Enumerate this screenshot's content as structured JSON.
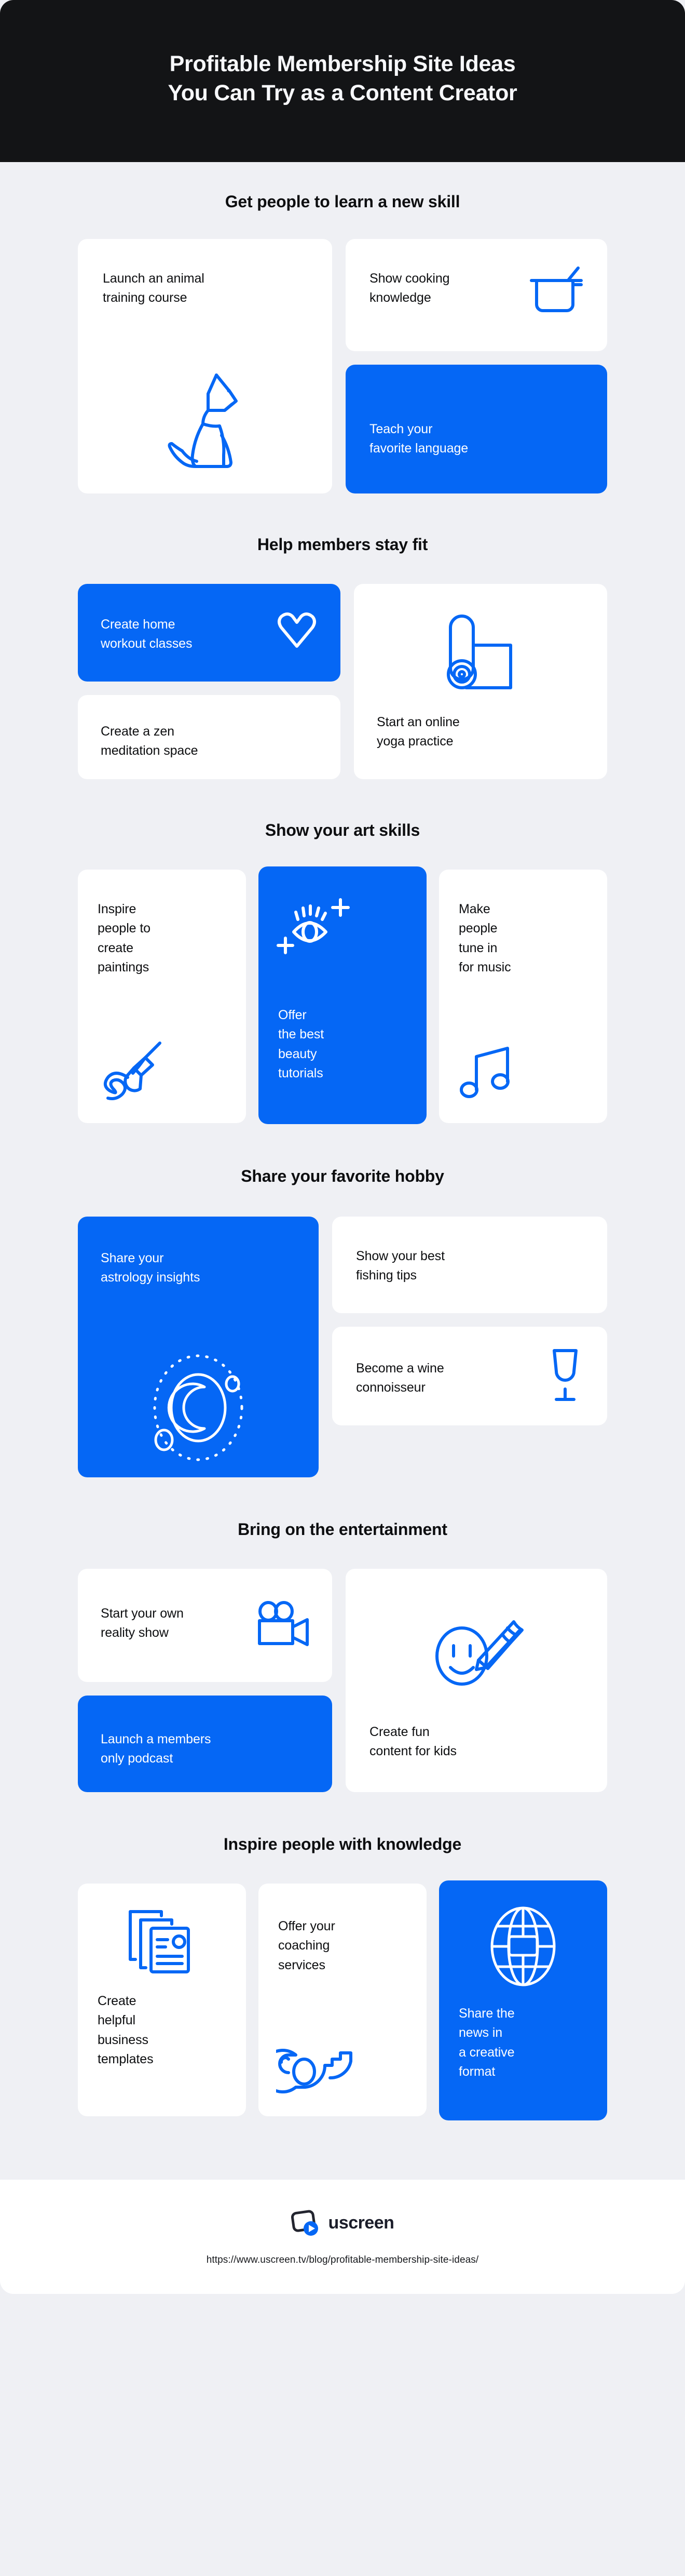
{
  "header": {
    "title_line1": "Profitable Membership Site Ideas",
    "title_line2": "You Can Try as a Content Creator",
    "bg_color": "#131416",
    "text_color": "#f7f8fb"
  },
  "theme": {
    "page_bg": "#eff0f4",
    "card_bg": "#ffffff",
    "accent_blue": "#0567f5",
    "text_dark": "#0d0e10",
    "text_on_blue": "#ffffff"
  },
  "sections": [
    {
      "heading": "Get people to learn a new skill",
      "cards": [
        {
          "label_line1": "Launch an animal",
          "label_line2": "training course",
          "icon": "dog-icon",
          "style": "white"
        },
        {
          "label_line1": "Show cooking",
          "label_line2": "knowledge",
          "icon": "cooking-pot-icon",
          "style": "white"
        },
        {
          "label_line1": "Teach your",
          "label_line2": "favorite language",
          "icon": null,
          "style": "blue"
        }
      ]
    },
    {
      "heading": "Help members stay fit",
      "cards": [
        {
          "label_line1": "Create home",
          "label_line2": "workout classes",
          "icon": "heart-icon",
          "style": "blue"
        },
        {
          "label_line1": "Create a zen",
          "label_line2": "meditation space",
          "icon": null,
          "style": "white"
        },
        {
          "label_line1": "Start an online",
          "label_line2": "yoga practice",
          "icon": "yoga-mat-icon",
          "style": "white"
        }
      ]
    },
    {
      "heading": "Show your art skills",
      "cards": [
        {
          "label_line1": "Inspire",
          "label_line2": "people to",
          "label_line3": "create",
          "label_line4": "paintings",
          "icon": "paintbrush-icon",
          "style": "white"
        },
        {
          "label_line1": "Offer",
          "label_line2": "the best",
          "label_line3": "beauty",
          "label_line4": "tutorials",
          "icon": "eye-sparkle-icon",
          "style": "blue"
        },
        {
          "label_line1": "Make",
          "label_line2": "people",
          "label_line3": "tune in",
          "label_line4": "for music",
          "icon": "music-note-icon",
          "style": "white"
        }
      ]
    },
    {
      "heading": "Share your favorite hobby",
      "cards": [
        {
          "label_line1": "Share your",
          "label_line2": "astrology insights",
          "icon": "moon-orbit-icon",
          "style": "blue"
        },
        {
          "label_line1": "Show your best",
          "label_line2": "fishing tips",
          "icon": null,
          "style": "white"
        },
        {
          "label_line1": "Become a wine",
          "label_line2": "connoisseur",
          "icon": "wine-glass-icon",
          "style": "white"
        }
      ]
    },
    {
      "heading": "Bring on the entertainment",
      "cards": [
        {
          "label_line1": "Start your own",
          "label_line2": "reality show",
          "icon": "video-camera-icon",
          "style": "white"
        },
        {
          "label_line1": "Launch a members",
          "label_line2": "only podcast",
          "icon": null,
          "style": "blue"
        },
        {
          "label_line1": "Create fun",
          "label_line2": "content for kids",
          "icon": "crayon-smiley-icon",
          "style": "white"
        }
      ]
    },
    {
      "heading": "Inspire people with knowledge",
      "cards": [
        {
          "label_line1": "Create",
          "label_line2": "helpful",
          "label_line3": "business",
          "label_line4": "templates",
          "icon": "documents-icon",
          "style": "white"
        },
        {
          "label_line1": "Offer your",
          "label_line2": "coaching",
          "label_line3": "services",
          "label_line4": "",
          "icon": "whistle-icon",
          "style": "white"
        },
        {
          "label_line1": "Share the",
          "label_line2": "news in",
          "label_line3": "a creative",
          "label_line4": "format",
          "icon": "globe-icon",
          "style": "blue"
        }
      ]
    }
  ],
  "footer": {
    "logo_word": "uscreen",
    "logo_icon": "uscreen-play-logo",
    "url": "https://www.uscreen.tv/blog/profitable-membership-site-ideas/"
  }
}
